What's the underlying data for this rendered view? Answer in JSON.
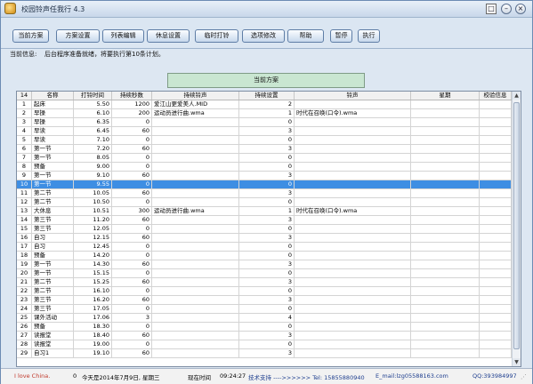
{
  "window": {
    "title": "校园铃声任我行 4.3",
    "controls": {
      "restore": "□",
      "minimize": "–",
      "close": "×"
    }
  },
  "toolbar": {
    "buttons": [
      "当前方案",
      "方案设置",
      "列表编辑",
      "休息设置",
      "临时打铃",
      "选项修改",
      "帮助",
      "暂停",
      "执行"
    ]
  },
  "info": {
    "label": "当前信息:",
    "message": "后台程序准备就绪，将要执行第10条计划。"
  },
  "banner": {
    "label": "当前方案"
  },
  "table": {
    "columns": [
      "14",
      "名称",
      "打铃时间",
      "持续秒数",
      "持续铃声",
      "持续设置",
      "铃声",
      "星期",
      "校验信息"
    ],
    "selected_index": 9,
    "rows": [
      [
        "1",
        "起床",
        "5.50",
        "1200",
        "爱江山更爱美人.MID",
        "2",
        "",
        "",
        ""
      ],
      [
        "2",
        "早操",
        "6.10",
        "200",
        "运动员进行曲.wma",
        "1",
        "时代在召唤(口令).wma",
        "",
        ""
      ],
      [
        "3",
        "早操",
        "6.35",
        "0",
        "",
        "0",
        "",
        "",
        ""
      ],
      [
        "4",
        "早读",
        "6.45",
        "60",
        "",
        "3",
        "",
        "",
        ""
      ],
      [
        "5",
        "早读",
        "7.10",
        "0",
        "",
        "0",
        "",
        "",
        ""
      ],
      [
        "6",
        "第一节",
        "7.20",
        "60",
        "",
        "3",
        "",
        "",
        ""
      ],
      [
        "7",
        "第一节",
        "8.05",
        "0",
        "",
        "0",
        "",
        "",
        ""
      ],
      [
        "8",
        "预备",
        "9.00",
        "0",
        "",
        "0",
        "",
        "",
        ""
      ],
      [
        "9",
        "第一节",
        "9.10",
        "60",
        "",
        "3",
        "",
        "",
        ""
      ],
      [
        "10",
        "第一节",
        "9.55",
        "0",
        "",
        "0",
        "",
        "",
        ""
      ],
      [
        "11",
        "第二节",
        "10.05",
        "60",
        "",
        "3",
        "",
        "",
        ""
      ],
      [
        "12",
        "第二节",
        "10.50",
        "0",
        "",
        "0",
        "",
        "",
        ""
      ],
      [
        "13",
        "大休息",
        "10.51",
        "300",
        "运动员进行曲.wma",
        "1",
        "时代在召唤(口令).wma",
        "",
        ""
      ],
      [
        "14",
        "第三节",
        "11.20",
        "60",
        "",
        "3",
        "",
        "",
        ""
      ],
      [
        "15",
        "第三节",
        "12.05",
        "0",
        "",
        "0",
        "",
        "",
        ""
      ],
      [
        "16",
        "自习",
        "12.15",
        "60",
        "",
        "3",
        "",
        "",
        ""
      ],
      [
        "17",
        "自习",
        "12.45",
        "0",
        "",
        "0",
        "",
        "",
        ""
      ],
      [
        "18",
        "预备",
        "14.20",
        "0",
        "",
        "0",
        "",
        "",
        ""
      ],
      [
        "19",
        "第一节",
        "14.30",
        "60",
        "",
        "3",
        "",
        "",
        ""
      ],
      [
        "20",
        "第一节",
        "15.15",
        "0",
        "",
        "0",
        "",
        "",
        ""
      ],
      [
        "21",
        "第二节",
        "15.25",
        "60",
        "",
        "3",
        "",
        "",
        ""
      ],
      [
        "22",
        "第二节",
        "16.10",
        "0",
        "",
        "0",
        "",
        "",
        ""
      ],
      [
        "23",
        "第三节",
        "16.20",
        "60",
        "",
        "3",
        "",
        "",
        ""
      ],
      [
        "24",
        "第三节",
        "17.05",
        "0",
        "",
        "0",
        "",
        "",
        ""
      ],
      [
        "25",
        "课外活动",
        "17.06",
        "3",
        "",
        "4",
        "",
        "",
        ""
      ],
      [
        "26",
        "预备",
        "18.30",
        "0",
        "",
        "0",
        "",
        "",
        ""
      ],
      [
        "27",
        "读报堂",
        "18.40",
        "60",
        "",
        "3",
        "",
        "",
        ""
      ],
      [
        "28",
        "读报堂",
        "19.00",
        "0",
        "",
        "0",
        "",
        "",
        ""
      ],
      [
        "29",
        "自习1",
        "19.10",
        "60",
        "",
        "3",
        "",
        "",
        ""
      ]
    ]
  },
  "status": {
    "love": "I love China.",
    "zero": "0",
    "today": "今天是2014年7月9日, 星期三",
    "now_label": "现在时间",
    "time": "09:24:27",
    "support": "技术支持 ---->>>>>> Tel: 15855880940",
    "email": "E_mail:lzg05588163.com",
    "qq": "QQ:393984997"
  },
  "colors": {
    "selection": "#3e8ee3",
    "banner": "#c9e6d1",
    "love_text": "#c0392b",
    "support_text": "#1f3f8f"
  }
}
